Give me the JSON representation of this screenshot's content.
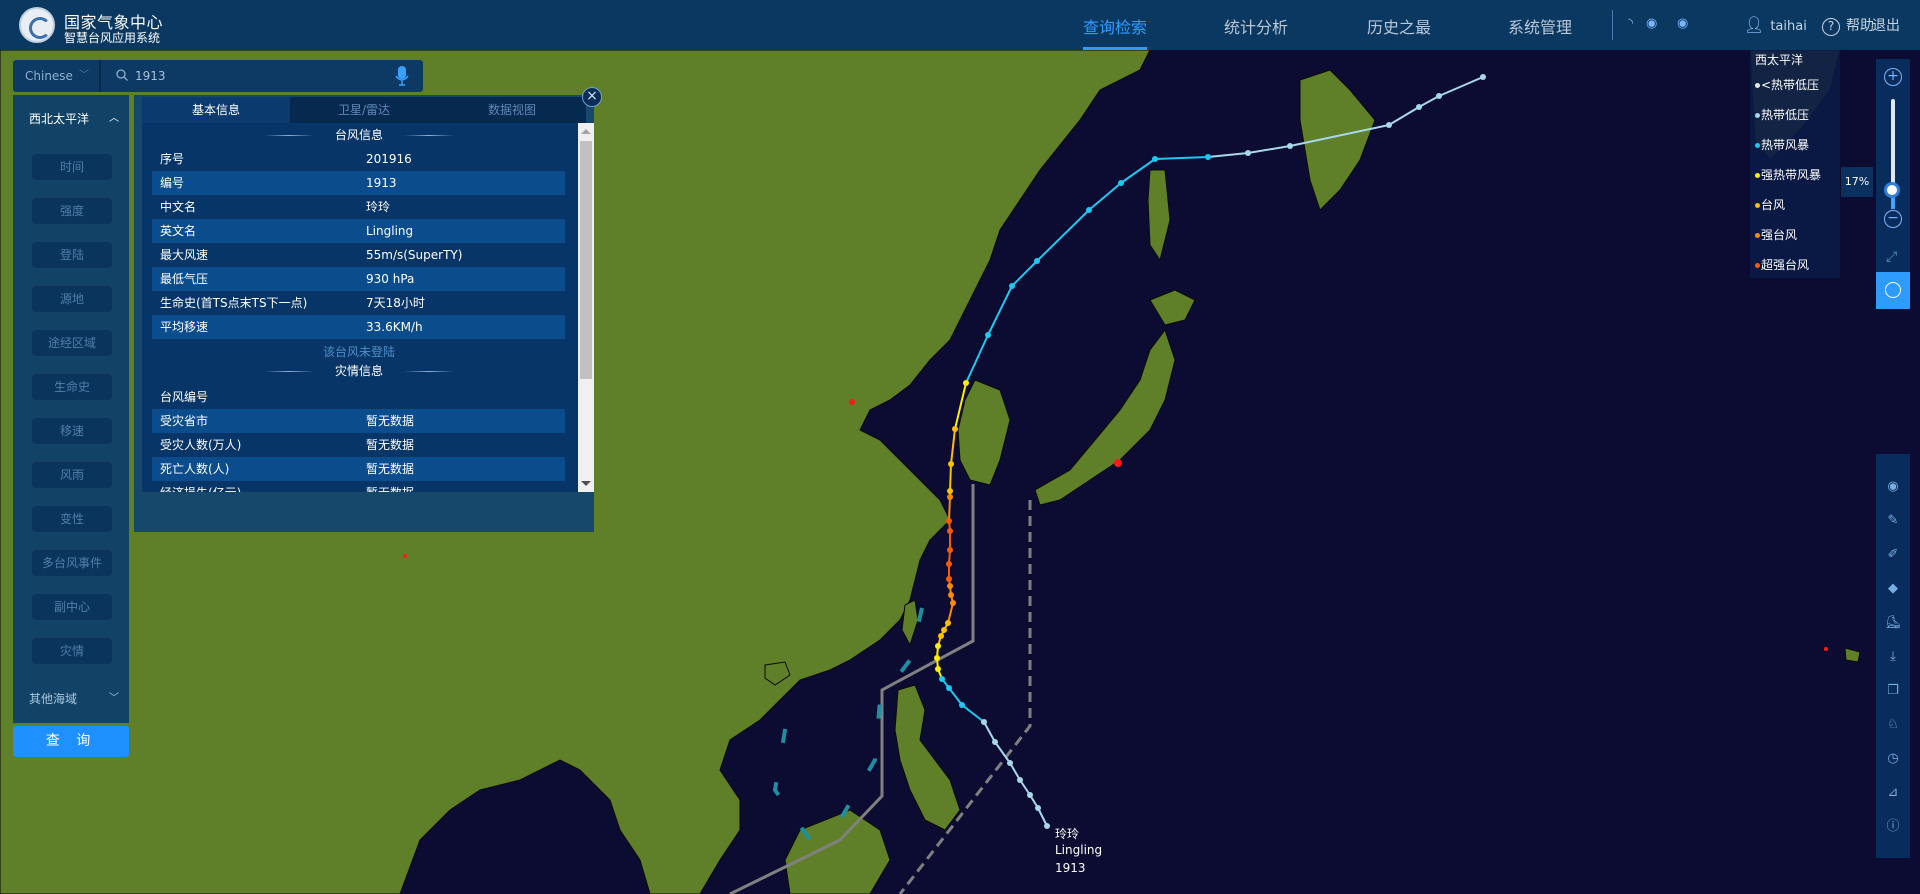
{
  "header": {
    "org_name": "国家气象中心",
    "system_name": "智慧台风应用系统",
    "nav": [
      {
        "label": "查询检索",
        "active": true
      },
      {
        "label": "统计分析",
        "active": false
      },
      {
        "label": "历史之最",
        "active": false
      },
      {
        "label": "系统管理",
        "active": false
      }
    ],
    "icons": [
      "loading-icon",
      "eye-icon",
      "eye-icon"
    ],
    "username": "taihai",
    "help_label": "帮助",
    "logout_label": "退出"
  },
  "search": {
    "language": "Chinese",
    "query": "1913",
    "placeholder": ""
  },
  "sidebar": {
    "region": "西北太平洋",
    "buttons": [
      "时间",
      "强度",
      "登陆",
      "源地",
      "途经区域",
      "生命史",
      "移速",
      "风雨",
      "变性",
      "多台风事件",
      "副中心",
      "灾情"
    ],
    "other_region": "其他海域",
    "query_label": "查 询"
  },
  "panel": {
    "tabs": [
      {
        "label": "基本信息",
        "active": true
      },
      {
        "label": "卫星/雷达",
        "active": false
      },
      {
        "label": "数据视图",
        "active": false
      }
    ],
    "typhoon_info_title": "台风信息",
    "typhoon_info": [
      {
        "key": "序号",
        "value": "201916"
      },
      {
        "key": "编号",
        "value": "1913"
      },
      {
        "key": "中文名",
        "value": "玲玲"
      },
      {
        "key": "英文名",
        "value": "Lingling"
      },
      {
        "key": "最大风速",
        "value": "55m/s(SuperTY)"
      },
      {
        "key": "最低气压",
        "value": "930 hPa"
      },
      {
        "key": "生命史(首TS点末TS下一点)",
        "value": "7天18小时"
      },
      {
        "key": "平均移速",
        "value": "33.6KM/h"
      }
    ],
    "landfall_note": "该台风未登陆",
    "disaster_info_title": "灾情信息",
    "disaster_info": [
      {
        "key": "台风编号",
        "value": ""
      },
      {
        "key": "受灾省市",
        "value": "暂无数据"
      },
      {
        "key": "受灾人数(万人)",
        "value": "暂无数据"
      },
      {
        "key": "死亡人数(人)",
        "value": "暂无数据"
      },
      {
        "key": "经济损失(亿元)",
        "value": "暂无数据"
      }
    ]
  },
  "legend": {
    "title": "西太平洋",
    "items": [
      {
        "label": "<热带低压",
        "color": "#e8e8e8"
      },
      {
        "label": "热带低压",
        "color": "#a8d8e8"
      },
      {
        "label": "热带风暴",
        "color": "#1ec8f0"
      },
      {
        "label": "强热带风暴",
        "color": "#ffee00"
      },
      {
        "label": "台风",
        "color": "#ffc000"
      },
      {
        "label": "强台风",
        "color": "#ff8a00"
      },
      {
        "label": "超强台风",
        "color": "#ff5a00"
      }
    ]
  },
  "zoom": {
    "percent_label": "17%",
    "level": 0.17
  },
  "toolbar": [
    "eye-icon",
    "dropper-icon",
    "pen-icon",
    "eraser-icon",
    "ruler-icon",
    "download-icon",
    "layers-icon",
    "china-map-icon",
    "clock-icon",
    "measure-icon",
    "info-icon"
  ],
  "typhoon_label": {
    "chinese_name": "玲玲",
    "english_name": "Lingling",
    "number": "1913"
  },
  "colors": {
    "accent": "#2e9bff",
    "header_bg": "#0a3a62",
    "land": "#5f7f28",
    "sea": "#0c0c33"
  }
}
